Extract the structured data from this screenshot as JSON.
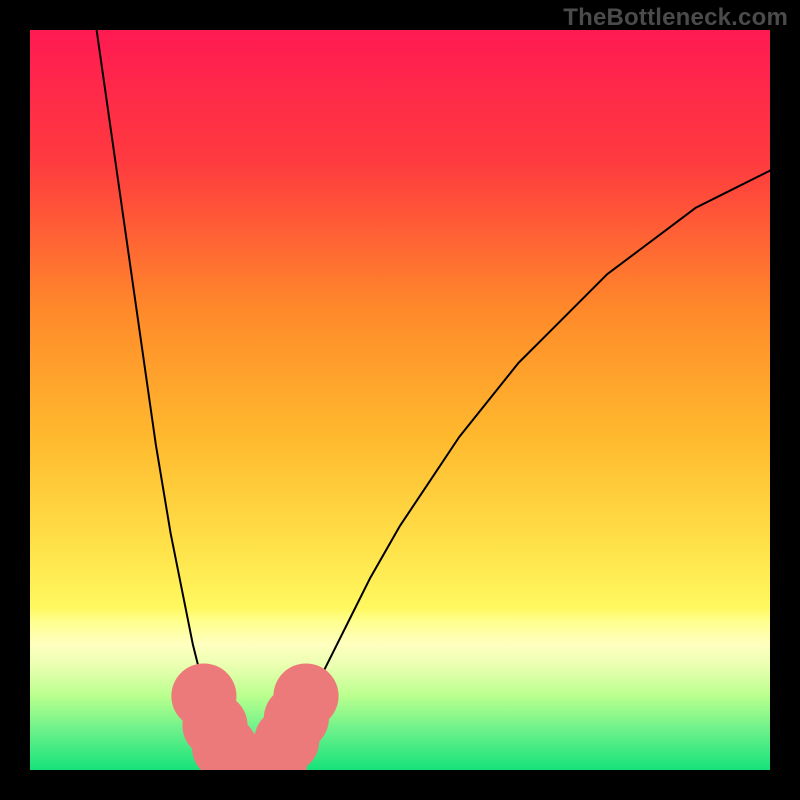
{
  "watermark": "TheBottleneck.com",
  "chart_data": {
    "type": "line",
    "title": "",
    "xlabel": "",
    "ylabel": "",
    "xlim": [
      0,
      100
    ],
    "ylim": [
      0,
      100
    ],
    "gradient_stops": [
      {
        "offset": 0,
        "color": "#ff1a52"
      },
      {
        "offset": 18,
        "color": "#ff3b3f"
      },
      {
        "offset": 38,
        "color": "#ff8a2a"
      },
      {
        "offset": 55,
        "color": "#ffb92e"
      },
      {
        "offset": 70,
        "color": "#ffe24a"
      },
      {
        "offset": 78,
        "color": "#fff85f"
      },
      {
        "offset": 80,
        "color": "#ffff90"
      },
      {
        "offset": 83,
        "color": "#ffffc0"
      },
      {
        "offset": 86,
        "color": "#e9ffb0"
      },
      {
        "offset": 90,
        "color": "#b9ff8e"
      },
      {
        "offset": 95,
        "color": "#66f08a"
      },
      {
        "offset": 100,
        "color": "#16e27a"
      }
    ],
    "series": [
      {
        "name": "left-branch",
        "x": [
          9,
          10,
          11,
          12,
          13,
          14,
          15,
          16,
          17,
          18,
          19,
          20,
          21,
          22,
          23,
          24,
          25,
          26,
          27,
          28
        ],
        "values": [
          100,
          93,
          86,
          79,
          72,
          65,
          58,
          51,
          44,
          38,
          32,
          27,
          22,
          17,
          13,
          9,
          6,
          4,
          2,
          0
        ]
      },
      {
        "name": "right-branch",
        "x": [
          33,
          35,
          37,
          40,
          43,
          46,
          50,
          54,
          58,
          62,
          66,
          70,
          74,
          78,
          82,
          86,
          90,
          94,
          98,
          100
        ],
        "values": [
          0,
          4,
          8,
          14,
          20,
          26,
          33,
          39,
          45,
          50,
          55,
          59,
          63,
          67,
          70,
          73,
          76,
          78,
          80,
          81
        ]
      },
      {
        "name": "valley-floor",
        "x": [
          28,
          29,
          30,
          31,
          32,
          33
        ],
        "values": [
          0,
          0,
          0,
          0,
          0,
          0
        ]
      }
    ],
    "markers": [
      {
        "x": 23.5,
        "y": 10,
        "color": "#ed7a7a",
        "r": 2.2
      },
      {
        "x": 25.0,
        "y": 6,
        "color": "#ed7a7a",
        "r": 2.2
      },
      {
        "x": 26.3,
        "y": 3,
        "color": "#ed7a7a",
        "r": 2.2
      },
      {
        "x": 28.0,
        "y": 0.5,
        "color": "#ed7a7a",
        "r": 2.2
      },
      {
        "x": 30.5,
        "y": 0.5,
        "color": "#ed7a7a",
        "r": 2.2
      },
      {
        "x": 33.0,
        "y": 0.5,
        "color": "#ed7a7a",
        "r": 2.2
      },
      {
        "x": 34.7,
        "y": 4,
        "color": "#ed7a7a",
        "r": 2.2
      },
      {
        "x": 36.0,
        "y": 7,
        "color": "#ed7a7a",
        "r": 2.2
      },
      {
        "x": 37.3,
        "y": 10,
        "color": "#ed7a7a",
        "r": 2.2
      }
    ]
  }
}
